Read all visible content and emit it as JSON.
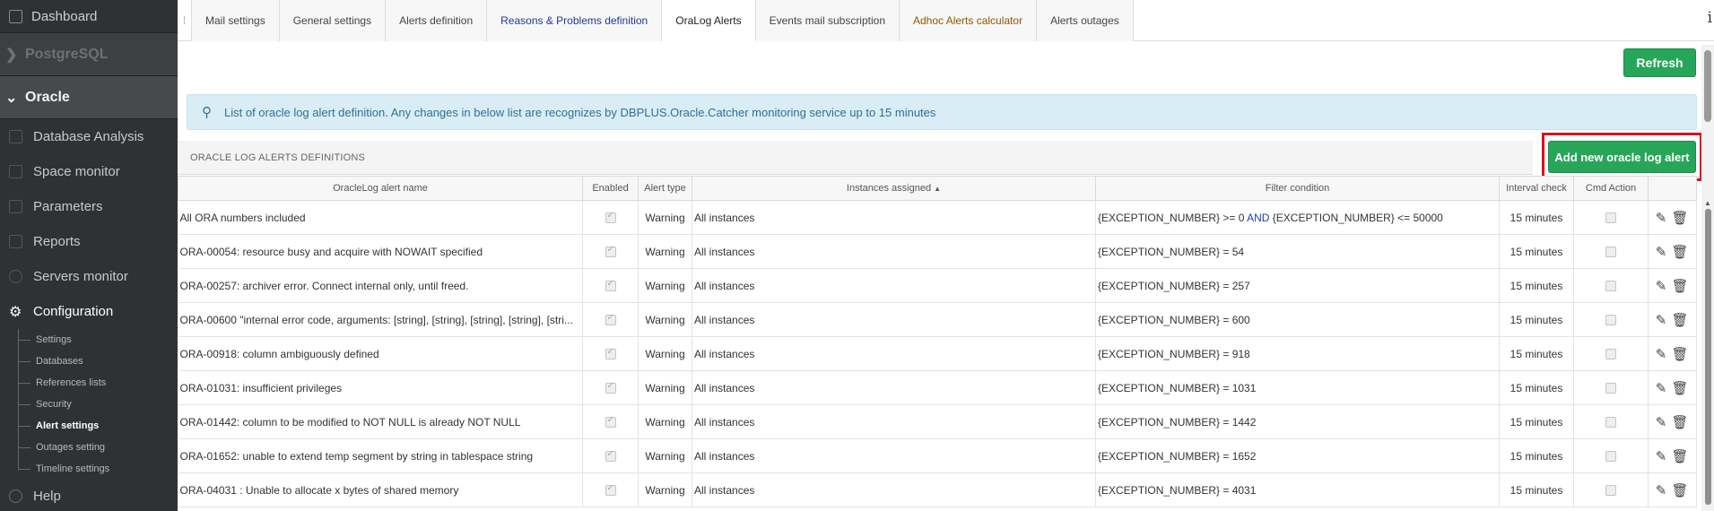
{
  "sidebar": {
    "dashboard": "Dashboard",
    "postgres": "PostgreSQL",
    "oracle": "Oracle",
    "items": [
      {
        "label": "Database Analysis"
      },
      {
        "label": "Space monitor"
      },
      {
        "label": "Parameters"
      },
      {
        "label": "Reports"
      },
      {
        "label": "Servers monitor"
      }
    ],
    "configuration": "Configuration",
    "sub_items": [
      "Settings",
      "Databases",
      "References lists",
      "Security",
      "Alert settings",
      "Outages setting",
      "Timeline settings"
    ],
    "active_sub_item": "Alert settings",
    "help": "Help"
  },
  "tabs": [
    {
      "label": "Mail settings",
      "style": "normal"
    },
    {
      "label": "General settings",
      "style": "normal"
    },
    {
      "label": "Alerts definition",
      "style": "normal"
    },
    {
      "label": "Reasons & Problems definition",
      "style": "blue"
    },
    {
      "label": "OraLog Alerts",
      "style": "active"
    },
    {
      "label": "Events mail subscription",
      "style": "normal"
    },
    {
      "label": "Adhoc Alerts calculator",
      "style": "brown"
    },
    {
      "label": "Alerts outages",
      "style": "normal"
    }
  ],
  "info_icon": "i",
  "toolbar": {
    "refresh_label": "Refresh"
  },
  "info_message": "List of oracle log alert definition. Any changes in below list are recognizes by DBPLUS.Oracle.Catcher monitoring service up to 15 minutes",
  "section_title": "ORACLE LOG ALERTS DEFINITIONS",
  "add_button_label": "Add new oracle log alert",
  "columns": {
    "name": "OracleLog alert name",
    "enabled": "Enabled",
    "type": "Alert type",
    "instances": "Instances assigned",
    "filter": "Filter condition",
    "interval": "Interval check",
    "cmd": "Cmd Action"
  },
  "sort_indicator": "▲",
  "rows": [
    {
      "name": "All ORA numbers included",
      "type": "Warning",
      "instances": "All instances",
      "filter_a": "{EXCEPTION_NUMBER} >= 0 ",
      "filter_kw": "AND",
      "filter_b": " {EXCEPTION_NUMBER} <= 50000",
      "interval": "15 minutes"
    },
    {
      "name": "ORA-00054: resource busy and acquire with NOWAIT specified",
      "type": "Warning",
      "instances": "All instances",
      "filter_a": "{EXCEPTION_NUMBER} = 54",
      "filter_kw": "",
      "filter_b": "",
      "interval": "15 minutes"
    },
    {
      "name": "ORA-00257: archiver error. Connect internal only, until freed.",
      "type": "Warning",
      "instances": "All instances",
      "filter_a": "{EXCEPTION_NUMBER} = 257",
      "filter_kw": "",
      "filter_b": "",
      "interval": "15 minutes"
    },
    {
      "name": "ORA-00600 \"internal error code, arguments: [string], [string], [string], [string], [stri...",
      "type": "Warning",
      "instances": "All instances",
      "filter_a": "{EXCEPTION_NUMBER} = 600",
      "filter_kw": "",
      "filter_b": "",
      "interval": "15 minutes"
    },
    {
      "name": "ORA-00918: column ambiguously defined",
      "type": "Warning",
      "instances": "All instances",
      "filter_a": "{EXCEPTION_NUMBER} = 918",
      "filter_kw": "",
      "filter_b": "",
      "interval": "15 minutes"
    },
    {
      "name": "ORA-01031: insufficient privileges",
      "type": "Warning",
      "instances": "All instances",
      "filter_a": "{EXCEPTION_NUMBER} = 1031",
      "filter_kw": "",
      "filter_b": "",
      "interval": "15 minutes"
    },
    {
      "name": "ORA-01442: column to be modified to NOT NULL is already NOT NULL",
      "type": "Warning",
      "instances": "All instances",
      "filter_a": "{EXCEPTION_NUMBER} = 1442",
      "filter_kw": "",
      "filter_b": "",
      "interval": "15 minutes"
    },
    {
      "name": "ORA-01652: unable to extend temp segment by string in tablespace string",
      "type": "Warning",
      "instances": "All instances",
      "filter_a": "{EXCEPTION_NUMBER} = 1652",
      "filter_kw": "",
      "filter_b": "",
      "interval": "15 minutes"
    },
    {
      "name": "ORA-04031 : Unable to allocate x bytes of shared memory",
      "type": "Warning",
      "instances": "All instances",
      "filter_a": "{EXCEPTION_NUMBER} = 4031",
      "filter_kw": "",
      "filter_b": "",
      "interval": "15 minutes"
    }
  ],
  "colors": {
    "sidebar_bg": "#2f3235",
    "button_green": "#27a65a",
    "highlight_red": "#e0101a",
    "warning_text": "#a07a2a",
    "info_bg": "#d9edf7"
  }
}
